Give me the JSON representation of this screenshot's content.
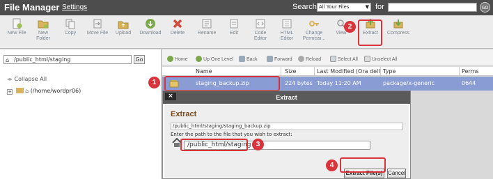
{
  "header": {
    "title": "File Manager",
    "settings": "Settings",
    "search_label": "Search",
    "search_scope": "All Your Files",
    "for_label": "for",
    "go_label": "GO"
  },
  "toolbar": [
    {
      "id": "new-file",
      "label": "New File",
      "icon": "new-file-icon",
      "color": "#9bbf55"
    },
    {
      "id": "new-folder",
      "label": "New\nFolder",
      "icon": "new-folder-icon",
      "color": "#d9b45a"
    },
    {
      "id": "copy",
      "label": "Copy",
      "icon": "copy-icon",
      "color": "#c8c8c8"
    },
    {
      "id": "move-file",
      "label": "Move File",
      "icon": "move-icon",
      "color": "#b0b0b0"
    },
    {
      "id": "upload",
      "label": "Upload",
      "icon": "upload-icon",
      "color": "#d6b154"
    },
    {
      "id": "download",
      "label": "Download",
      "icon": "download-icon",
      "color": "#7aa84b"
    },
    {
      "id": "delete",
      "label": "Delete",
      "icon": "delete-icon",
      "color": "#d44b3d"
    },
    {
      "id": "rename",
      "label": "Rename",
      "icon": "rename-icon",
      "color": "#bbbbbb"
    },
    {
      "id": "edit",
      "label": "Edit",
      "icon": "edit-icon",
      "color": "#bbbbbb"
    },
    {
      "id": "code-editor",
      "label": "Code\nEditor",
      "icon": "code-editor-icon",
      "color": "#bbbbbb"
    },
    {
      "id": "html-editor",
      "label": "HTML\nEditor",
      "icon": "html-editor-icon",
      "color": "#bbbbbb"
    },
    {
      "id": "change-permissions",
      "label": "Change\nPermissi...",
      "icon": "key-icon",
      "color": "#d9b45a"
    },
    {
      "id": "view",
      "label": "View",
      "icon": "view-icon",
      "color": "#bbbbbb"
    },
    {
      "id": "extract",
      "label": "Extract",
      "icon": "extract-icon",
      "color": "#6aa84f"
    },
    {
      "id": "compress",
      "label": "Compress",
      "icon": "compress-icon",
      "color": "#6aa84f"
    }
  ],
  "left": {
    "path": "/public_html/staging",
    "go": "Go",
    "collapse_all": "Collapse All",
    "tree_home": "(/home/wordpr06)"
  },
  "nav": [
    {
      "label": "Home",
      "icon": "home-icon"
    },
    {
      "label": "Up One Level",
      "icon": "up-icon"
    },
    {
      "label": "Back",
      "icon": "back-icon"
    },
    {
      "label": "Forward",
      "icon": "forward-icon"
    },
    {
      "label": "Reload",
      "icon": "reload-icon"
    },
    {
      "label": "Select All",
      "icon": "select-all-icon"
    },
    {
      "label": "Unselect All",
      "icon": "unselect-all-icon"
    }
  ],
  "table": {
    "headers": [
      "Name",
      "Size",
      "Last Modified (Ora dell'Ir",
      "Type",
      "Perms"
    ],
    "rows": [
      {
        "name": "staging_backup.zip",
        "size": "224 bytes",
        "modified": "Today 11:20 AM",
        "type": "package/x-generic",
        "perms": "0644"
      }
    ]
  },
  "modal": {
    "title": "Extract",
    "close": "×",
    "heading": "Extract",
    "file_path": "/public_html/staging/staging_backup.zip",
    "instruction": "Enter the path to the file that you wish to extract:",
    "destination": "/public_html/staging",
    "extract_button": "Extract File(s)",
    "cancel_button": "Cancel"
  },
  "callouts": [
    "1",
    "2",
    "3",
    "4"
  ],
  "colors": {
    "accent": "#d9343b",
    "header_bg": "#4d4d4d",
    "selected_row": "#8a9cd4"
  }
}
